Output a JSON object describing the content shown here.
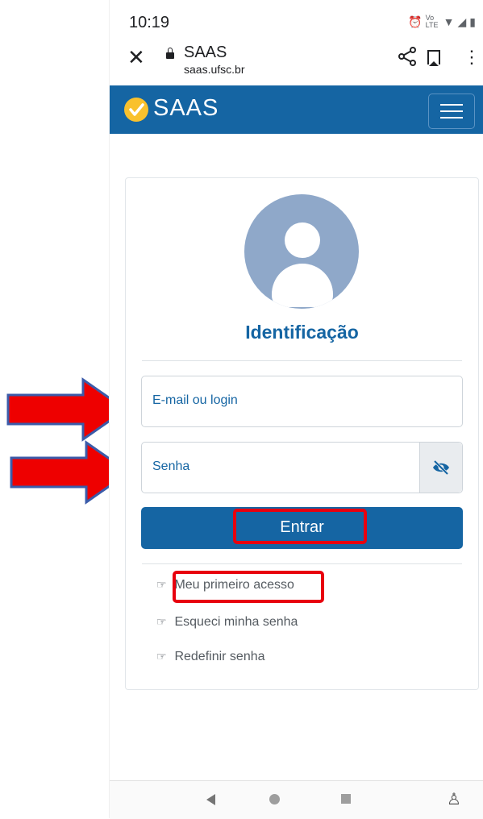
{
  "status_bar": {
    "time": "10:19",
    "indicators": [
      "alarm-icon",
      "volte-icon",
      "wifi-icon",
      "signal-icon",
      "battery-icon"
    ],
    "volte_label": "Vo LTE"
  },
  "browser": {
    "close_icon": "close-icon",
    "page_title": "SAAS",
    "url": "saas.ufsc.br",
    "actions": [
      "share-icon",
      "bookmark-icon",
      "more-vert-icon"
    ]
  },
  "navbar": {
    "logo_text": "SAAS",
    "logo_icon": "check-circle-icon",
    "menu_icon": "hamburger-icon",
    "color": "#1565a3"
  },
  "login": {
    "heading": "Identificação",
    "email_placeholder": "E-mail ou login",
    "password_placeholder": "Senha",
    "submit_label": "Entrar",
    "links": [
      {
        "label": "Meu primeiro acesso",
        "icon": "pointing-hand-icon"
      },
      {
        "label": "Esqueci minha senha",
        "icon": "pointing-hand-icon"
      },
      {
        "label": "Redefinir senha",
        "icon": "pointing-hand-icon"
      }
    ]
  },
  "annotations": {
    "arrow_color": "#ee0000",
    "box_color": "#e8000e"
  },
  "system_nav": [
    "back-icon",
    "home-icon",
    "recents-icon",
    "accessibility-icon"
  ]
}
